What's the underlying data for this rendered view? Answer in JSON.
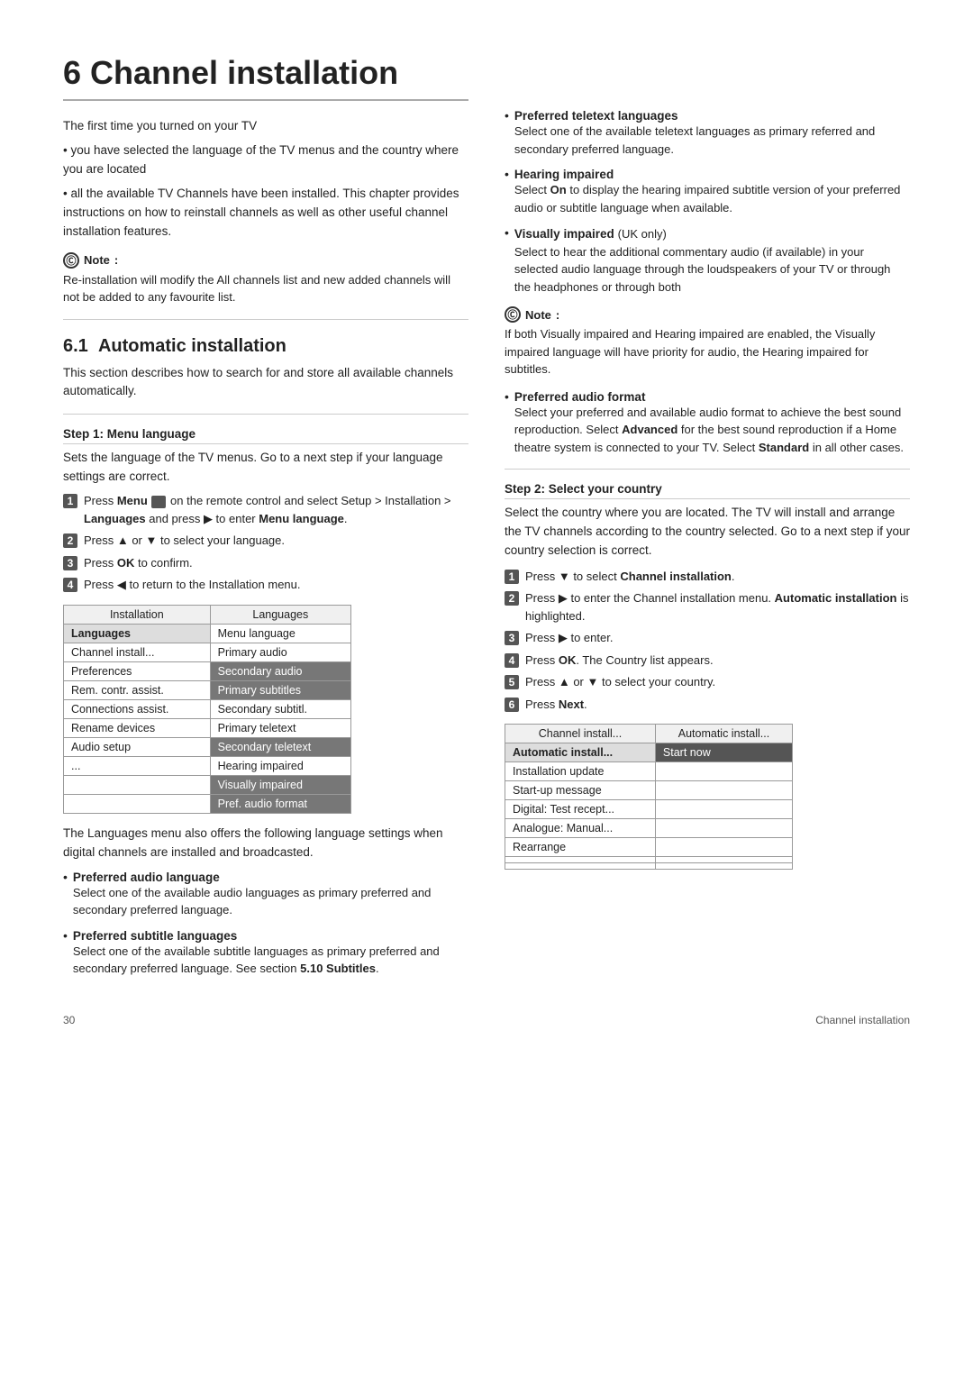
{
  "chapter": {
    "num": "6",
    "title": "Channel installation",
    "intro_lines": [
      "The first time you turned on your TV",
      "• you have selected the language of the TV menus and the country where you are located",
      "• all the available TV Channels have been installed. This chapter provides instructions on how to reinstall channels as well as other useful channel installation features."
    ]
  },
  "note1": {
    "label": "Note",
    "text": "Re-installation will modify the All channels list and new added channels will not be added to any favourite list."
  },
  "section1": {
    "num": "6.1",
    "title": "Automatic installation",
    "intro": "This section describes how to search for and store all available channels automatically."
  },
  "step1": {
    "heading": "Step 1: Menu language",
    "desc": "Sets the language of the TV menus. Go to a next step if your language settings are correct.",
    "steps": [
      "Press Menu  on the remote control and select Setup > Installation > Languages and press ▶ to enter Menu language.",
      "Press ▲ or ▼ to select your language.",
      "Press OK to confirm.",
      "Press ◀ to return to the Installation menu."
    ]
  },
  "lang_table": {
    "col1_header": "Installation",
    "col2_header": "Languages",
    "rows": [
      {
        "col1": "Languages",
        "col1_class": "selected-left",
        "col2": "Menu language",
        "col2_class": ""
      },
      {
        "col1": "Channel install...",
        "col1_class": "",
        "col2": "Primary audio",
        "col2_class": ""
      },
      {
        "col1": "Preferences",
        "col1_class": "",
        "col2": "Secondary audio",
        "col2_class": "highlighted"
      },
      {
        "col1": "Rem. contr. assist.",
        "col1_class": "",
        "col2": "Primary subtitles",
        "col2_class": "highlighted"
      },
      {
        "col1": "Connections assist.",
        "col1_class": "",
        "col2": "Secondary subtitl.",
        "col2_class": ""
      },
      {
        "col1": "Rename devices",
        "col1_class": "",
        "col2": "Primary teletext",
        "col2_class": ""
      },
      {
        "col1": "Audio setup",
        "col1_class": "",
        "col2": "Secondary teletext",
        "col2_class": "highlighted"
      },
      {
        "col1": "...",
        "col1_class": "",
        "col2": "Hearing impaired",
        "col2_class": ""
      },
      {
        "col1": "",
        "col1_class": "",
        "col2": "Visually impaired",
        "col2_class": "highlighted"
      },
      {
        "col1": "",
        "col1_class": "",
        "col2": "Pref. audio format",
        "col2_class": "highlighted"
      }
    ]
  },
  "lang_section": {
    "intro": "The Languages menu also offers the following language settings when digital channels are installed and broadcasted.",
    "items": [
      {
        "title": "Preferred audio language",
        "text": "Select one of the available audio languages as primary preferred and secondary preferred language."
      },
      {
        "title": "Preferred subtitle languages",
        "text": "Select one of the available subtitle languages as primary preferred and secondary preferred language. See section 5.10 Subtitles."
      }
    ]
  },
  "right_col": {
    "items_top": [
      {
        "title": "Preferred teletext languages",
        "text": "Select one of the available teletext languages as primary referred and secondary preferred language."
      },
      {
        "title": "Hearing impaired",
        "text": "Select On to display the hearing impaired subtitle version of your preferred audio or subtitle language when available."
      },
      {
        "title": "Visually impaired (UK only)",
        "text": "Select to hear the additional commentary audio (if available) in your selected audio language through the loudspeakers of your TV or through the headphones or through both"
      }
    ],
    "note2": {
      "label": "Note",
      "text": "If both Visually impaired and Hearing impaired are enabled, the Visually impaired language will have priority for audio, the Hearing impaired for subtitles."
    },
    "items_bottom": [
      {
        "title": "Preferred audio format",
        "text": "Select your preferred and available audio format to achieve the best sound reproduction. Select Advanced for the best sound reproduction if a Home theatre system is connected to your TV. Select Standard in all other cases."
      }
    ]
  },
  "step2": {
    "heading": "Step 2:  Select your country",
    "desc": "Select the country where you are located. The TV will install and arrange the TV channels according to the country selected. Go to a next step if your country selection is correct.",
    "steps": [
      "Press ▼ to select Channel installation.",
      "Press ▶ to enter the Channel installation menu. Automatic installation is highlighted.",
      "Press ▶ to enter.",
      "Press OK. The Country list appears.",
      "Press ▲ or ▼ to select your country.",
      "Press Next."
    ]
  },
  "install_table": {
    "col1_header": "Channel install...",
    "col2_header": "Automatic install...",
    "rows": [
      {
        "col1": "Automatic install...",
        "col1_class": "selected-left",
        "col2": "Start now",
        "col2_class": "selected-right"
      },
      {
        "col1": "Installation update",
        "col1_class": "",
        "col2": "",
        "col2_class": ""
      },
      {
        "col1": "Start-up message",
        "col1_class": "",
        "col2": "",
        "col2_class": ""
      },
      {
        "col1": "Digital: Test recept...",
        "col1_class": "",
        "col2": "",
        "col2_class": ""
      },
      {
        "col1": "Analogue: Manual...",
        "col1_class": "",
        "col2": "",
        "col2_class": ""
      },
      {
        "col1": "Rearrange",
        "col1_class": "",
        "col2": "",
        "col2_class": ""
      },
      {
        "col1": "",
        "col1_class": "",
        "col2": "",
        "col2_class": ""
      },
      {
        "col1": "",
        "col1_class": "",
        "col2": "",
        "col2_class": ""
      }
    ]
  },
  "footer": {
    "page_num": "30",
    "section_label": "Channel installation"
  }
}
